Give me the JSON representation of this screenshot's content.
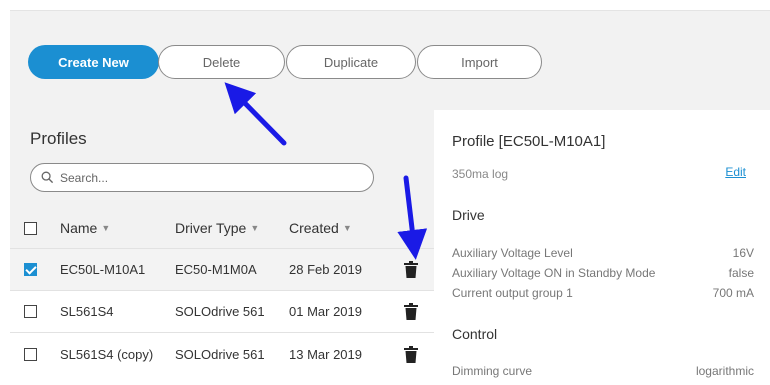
{
  "toolbar": {
    "create_label": "Create New",
    "delete_label": "Delete",
    "duplicate_label": "Duplicate",
    "import_label": "Import"
  },
  "profiles": {
    "title": "Profiles",
    "search_placeholder": "Search...",
    "columns": {
      "name": "Name",
      "driver_type": "Driver Type",
      "created": "Created"
    },
    "rows": [
      {
        "name": "EC50L-M10A1",
        "driver_type": "EC50-M1M0A",
        "created": "28 Feb 2019",
        "checked": true
      },
      {
        "name": "SL561S4",
        "driver_type": "SOLOdrive 561",
        "created": "01 Mar 2019",
        "checked": false
      },
      {
        "name": "SL561S4 (copy)",
        "driver_type": "SOLOdrive 561",
        "created": "13 Mar 2019",
        "checked": false
      }
    ]
  },
  "detail": {
    "title": "Profile [EC50L-M10A1]",
    "description": "350ma log",
    "edit_label": "Edit",
    "drive_heading": "Drive",
    "drive_props": [
      {
        "label": "Auxiliary Voltage Level",
        "value": "16V"
      },
      {
        "label": "Auxiliary Voltage ON in Standby Mode",
        "value": "false"
      },
      {
        "label": "Current output group 1",
        "value": "700 mA"
      }
    ],
    "control_heading": "Control",
    "control_props": [
      {
        "label": "Dimming curve",
        "value": "logarithmic"
      }
    ]
  },
  "colors": {
    "accent": "#1b8fd2",
    "annotation_arrow": "#1a1ae6"
  }
}
